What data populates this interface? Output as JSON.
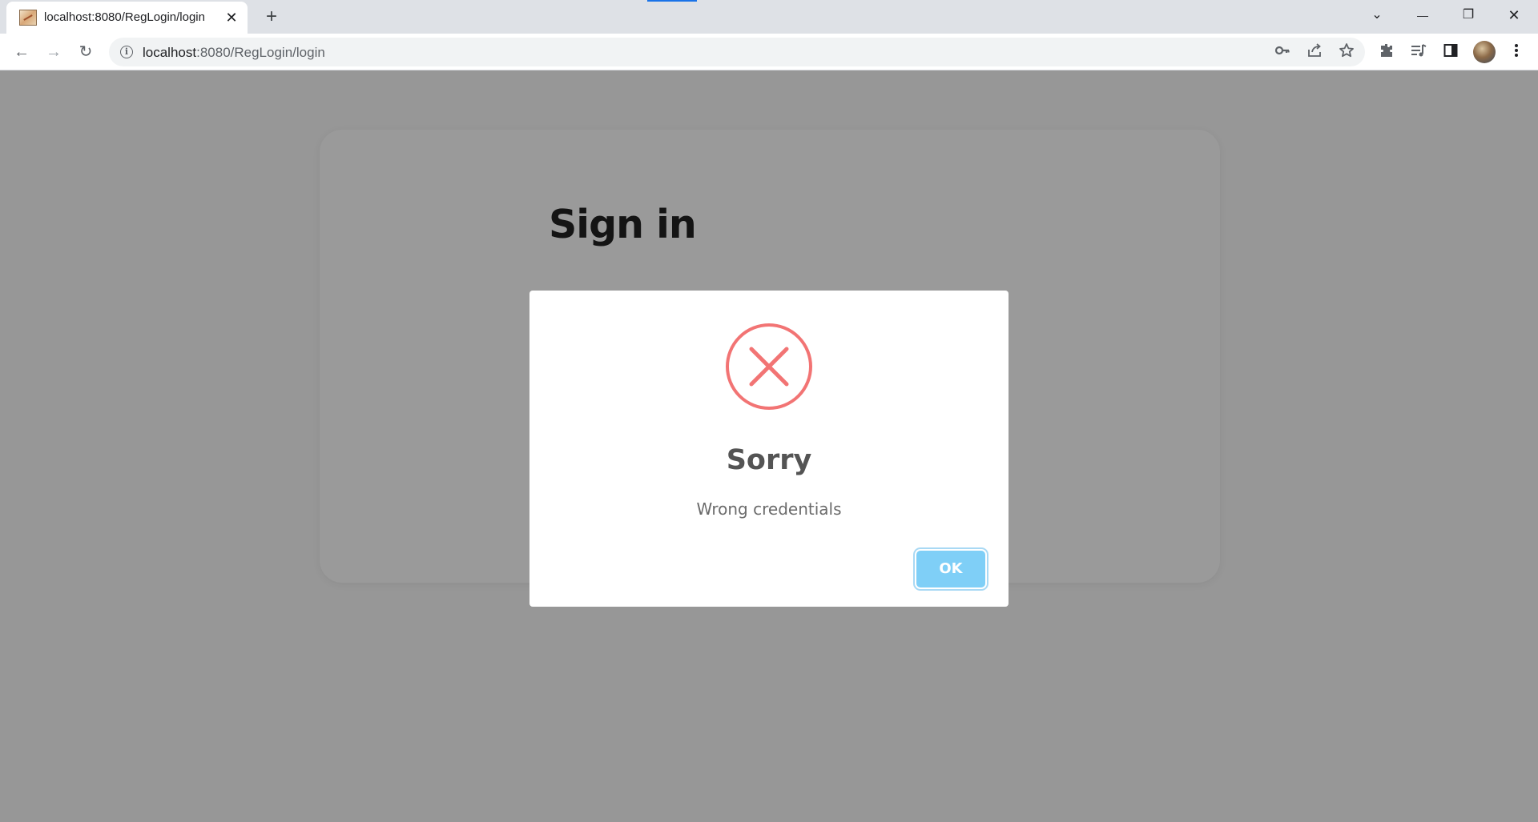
{
  "browser": {
    "tab": {
      "title": "localhost:8080/RegLogin/login",
      "close": "✕"
    },
    "new_tab": "+",
    "window_controls": {
      "tab_search": "⌄",
      "minimize": "—",
      "restore": "❐",
      "close": "✕"
    },
    "nav": {
      "back": "←",
      "forward": "→",
      "reload": "↻"
    },
    "address": {
      "host": "localhost",
      "path": ":8080/RegLogin/login",
      "info": "i"
    },
    "omni_icons": {
      "password": "key-icon",
      "share": "share-icon",
      "bookmark": "star-icon"
    },
    "toolbar_icons": [
      "extensions-icon",
      "media-control-icon",
      "side-panel-icon",
      "avatar",
      "menu-icon"
    ]
  },
  "page": {
    "signin_title": "Sign in"
  },
  "dialog": {
    "title": "Sorry",
    "message": "Wrong credentials",
    "ok_label": "OK",
    "colors": {
      "error_red": "#f27474",
      "confirm_button": "#7fcff7",
      "overlay": "#979797"
    }
  }
}
